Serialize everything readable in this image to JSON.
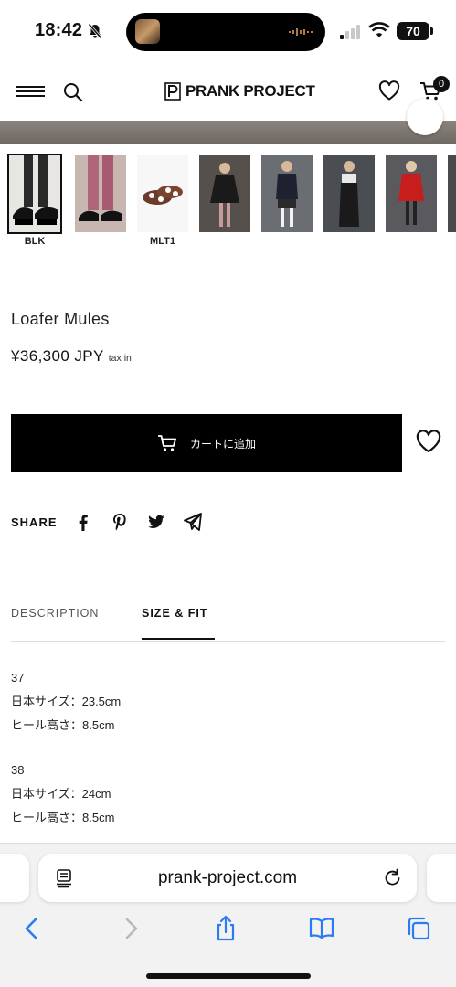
{
  "status_bar": {
    "time": "18:42",
    "battery": "70"
  },
  "header": {
    "logo_text": "PRANK PROJECT",
    "cart_count": "0"
  },
  "thumbnails": [
    {
      "label": "BLK",
      "selected": true
    },
    {
      "label": "",
      "selected": false
    },
    {
      "label": "MLT1",
      "selected": false
    },
    {
      "label": "",
      "selected": false
    },
    {
      "label": "",
      "selected": false
    },
    {
      "label": "",
      "selected": false
    },
    {
      "label": "",
      "selected": false
    }
  ],
  "product": {
    "title": "Loafer Mules",
    "price": "¥36,300 JPY",
    "tax_note": "tax in",
    "add_to_cart_label": "カートに追加"
  },
  "share": {
    "label": "SHARE",
    "icons": [
      "facebook-icon",
      "pinterest-icon",
      "twitter-icon",
      "telegram-icon"
    ]
  },
  "tabs": [
    {
      "label": "DESCRIPTION",
      "active": false
    },
    {
      "label": "SIZE & FIT",
      "active": true
    }
  ],
  "sizes": [
    {
      "size": "37",
      "jp_size": "日本サイズ：23.5cm",
      "heel": "ヒール高さ：8.5cm"
    },
    {
      "size": "38",
      "jp_size": "日本サイズ：24cm",
      "heel": "ヒール高さ：8.5cm"
    }
  ],
  "browser": {
    "url": "prank-project.com"
  },
  "colors": {
    "accent": "#000000",
    "hero_gray": "#7c7671"
  }
}
